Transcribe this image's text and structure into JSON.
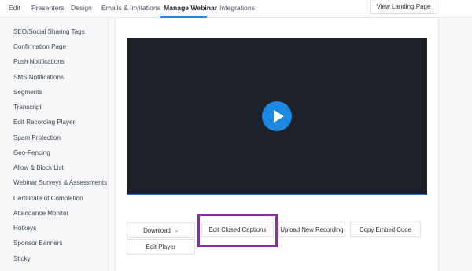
{
  "tabs": [
    {
      "label": "Edit"
    },
    {
      "label": "Presenters"
    },
    {
      "label": "Design"
    },
    {
      "label": "Emails & Invitations"
    },
    {
      "label": "Manage Webinar",
      "active": true
    },
    {
      "label": "Integrations"
    }
  ],
  "landing_button": "View Landing Page",
  "sidebar": {
    "items": [
      "SEO/Social Sharing Tags",
      "Confirmation Page",
      "Push Notifications",
      "SMS Notifications",
      "Segments",
      "Transcript",
      "Edit Recording Player",
      "Spam Protection",
      "Geo-Fencing",
      "Allow & Block List",
      "Webinar Surveys & Assessments",
      "Certificate of Completion",
      "Attendance Monitor",
      "Hotkeys",
      "Sponsor Banners",
      "Sticky"
    ]
  },
  "video": {
    "play_icon": "play-icon",
    "background": "#1e2129",
    "accent": "#1e88e5"
  },
  "actions": {
    "download": "Download",
    "edit_captions": "Edit Closed Captions",
    "upload_recording": "Upload New Recording",
    "copy_embed": "Copy Embed Code",
    "edit_player": "Edit Player"
  },
  "colors": {
    "highlight": "#8a2ea3",
    "active_tab": "#2b84e8"
  }
}
